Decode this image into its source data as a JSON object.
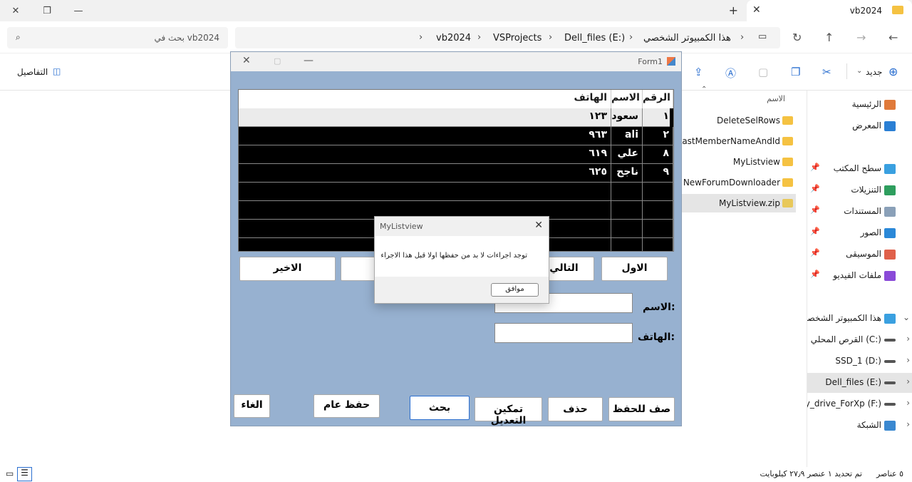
{
  "explorer": {
    "tab_title": "vb2024",
    "new_tab": "+",
    "search_placeholder": "بحث في vb2024",
    "breadcrumbs": [
      "هذا الكمبيوتر الشخصي",
      "Dell_files (E:)",
      "VSProjects",
      "vb2024"
    ],
    "toolbar": {
      "new_label": "جديد",
      "details_label": "التفاصيل"
    },
    "column_name": "الاسم",
    "files": [
      "DeleteSelRows",
      "LastMemberNameAndId",
      "MyListview",
      "NewForumDownloader",
      "MyListview.zip"
    ],
    "sidebar": [
      {
        "label": "الرئيسية",
        "icon": "home-icon",
        "color": "#e07a3a"
      },
      {
        "label": "المعرض",
        "icon": "gallery-icon",
        "color": "#2a7fd4"
      },
      {
        "label": "سطح المكتب",
        "icon": "desktop-icon",
        "color": "#3aa0e0",
        "pinned": true
      },
      {
        "label": "التنزيلات",
        "icon": "download-icon",
        "color": "#2e9e5e",
        "pinned": true
      },
      {
        "label": "المستندات",
        "icon": "documents-icon",
        "color": "#8aa0b8",
        "pinned": true
      },
      {
        "label": "الصور",
        "icon": "pictures-icon",
        "color": "#2a88d8",
        "pinned": true
      },
      {
        "label": "الموسيقى",
        "icon": "music-icon",
        "color": "#e0604a",
        "pinned": true
      },
      {
        "label": "ملفات الفيديو",
        "icon": "video-icon",
        "color": "#8a4ad8",
        "pinned": true
      },
      {
        "label": "هذا الكمبيوتر الشخصي",
        "icon": "computer-icon",
        "color": "#3aa0e0"
      },
      {
        "label": "القرص المحلي (C:)",
        "icon": "drive-icon",
        "color": "#555555"
      },
      {
        "label": "SSD_1 (D:)",
        "icon": "drive-icon",
        "color": "#555555"
      },
      {
        "label": "Dell_files (E:)",
        "icon": "drive-icon",
        "color": "#555555"
      },
      {
        "label": "My_drive_ForXp (F:)",
        "icon": "drive-icon",
        "color": "#555555"
      },
      {
        "label": "الشبكة",
        "icon": "network-icon",
        "color": "#3a88d0"
      }
    ],
    "status_left": "٥ عناصر",
    "status_right": "تم تحديد ١ عنصر ٢٧٫٩ كيلوبايت"
  },
  "form1": {
    "title": "Form1",
    "listview": {
      "columns": [
        "الرقم",
        "الاسم",
        "الهاتف"
      ],
      "rows": [
        [
          "١",
          "سعود",
          "١٢٣"
        ],
        [
          "٢",
          "ali",
          "٩٦٣"
        ],
        [
          "٨",
          "علي",
          "٦١٩"
        ],
        [
          "٩",
          "ناجح",
          "٦٢٥"
        ]
      ]
    },
    "nav_buttons": {
      "first": "الاول",
      "next": "التالي",
      "last": "الاخير"
    },
    "labels": {
      "name": "الاسم:",
      "phone": "الهاتف:"
    },
    "bottom_buttons": {
      "new_row": "صف للحفظ",
      "delete": "حذف",
      "enable_edit": "تمكين التعديل",
      "search": "بحث",
      "save_all": "حفظ عام",
      "cancel": "الغاء"
    }
  },
  "messagebox": {
    "title": "MyListview",
    "text": "توجد اجراءات لا بد من حفظها اولا قبل هذا الاجراء",
    "ok": "موافق"
  }
}
